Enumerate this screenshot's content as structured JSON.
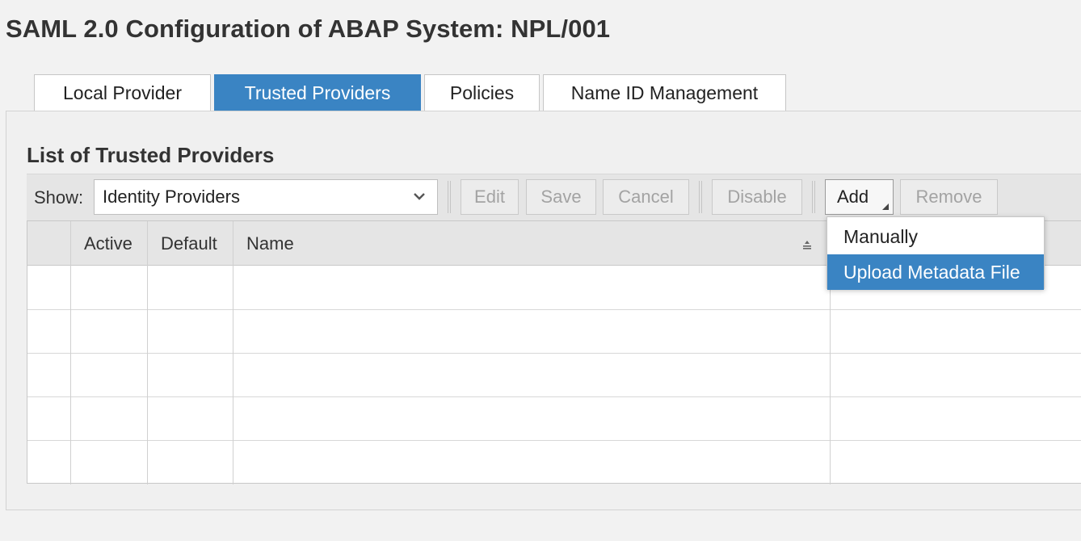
{
  "page": {
    "title": "SAML 2.0 Configuration of ABAP System: NPL/001"
  },
  "tabs": [
    {
      "label": "Local Provider",
      "selected": false
    },
    {
      "label": "Trusted Providers",
      "selected": true
    },
    {
      "label": "Policies",
      "selected": false
    },
    {
      "label": "Name ID Management",
      "selected": false
    }
  ],
  "section": {
    "title": "List of Trusted Providers"
  },
  "toolbar": {
    "show_label": "Show:",
    "show_value": "Identity Providers",
    "edit": "Edit",
    "save": "Save",
    "cancel": "Cancel",
    "disable": "Disable",
    "add": "Add",
    "remove": "Remove"
  },
  "table": {
    "columns": [
      "",
      "Active",
      "Default",
      "Name",
      ""
    ],
    "rows": [
      [
        "",
        "",
        "",
        "",
        ""
      ],
      [
        "",
        "",
        "",
        "",
        ""
      ],
      [
        "",
        "",
        "",
        "",
        ""
      ],
      [
        "",
        "",
        "",
        "",
        ""
      ],
      [
        "",
        "",
        "",
        "",
        ""
      ]
    ]
  },
  "add_menu": {
    "items": [
      {
        "label": "Manually",
        "highlighted": false
      },
      {
        "label": "Upload Metadata File",
        "highlighted": true
      }
    ]
  },
  "icons": {
    "select_arrow": "chevron-down-icon",
    "sort": "sort-icon",
    "menu_indicator": "dropdown-corner-icon"
  },
  "colors": {
    "accent": "#3a84c3",
    "background": "#f2f2f2",
    "disabled_text": "#a3a3a3"
  }
}
